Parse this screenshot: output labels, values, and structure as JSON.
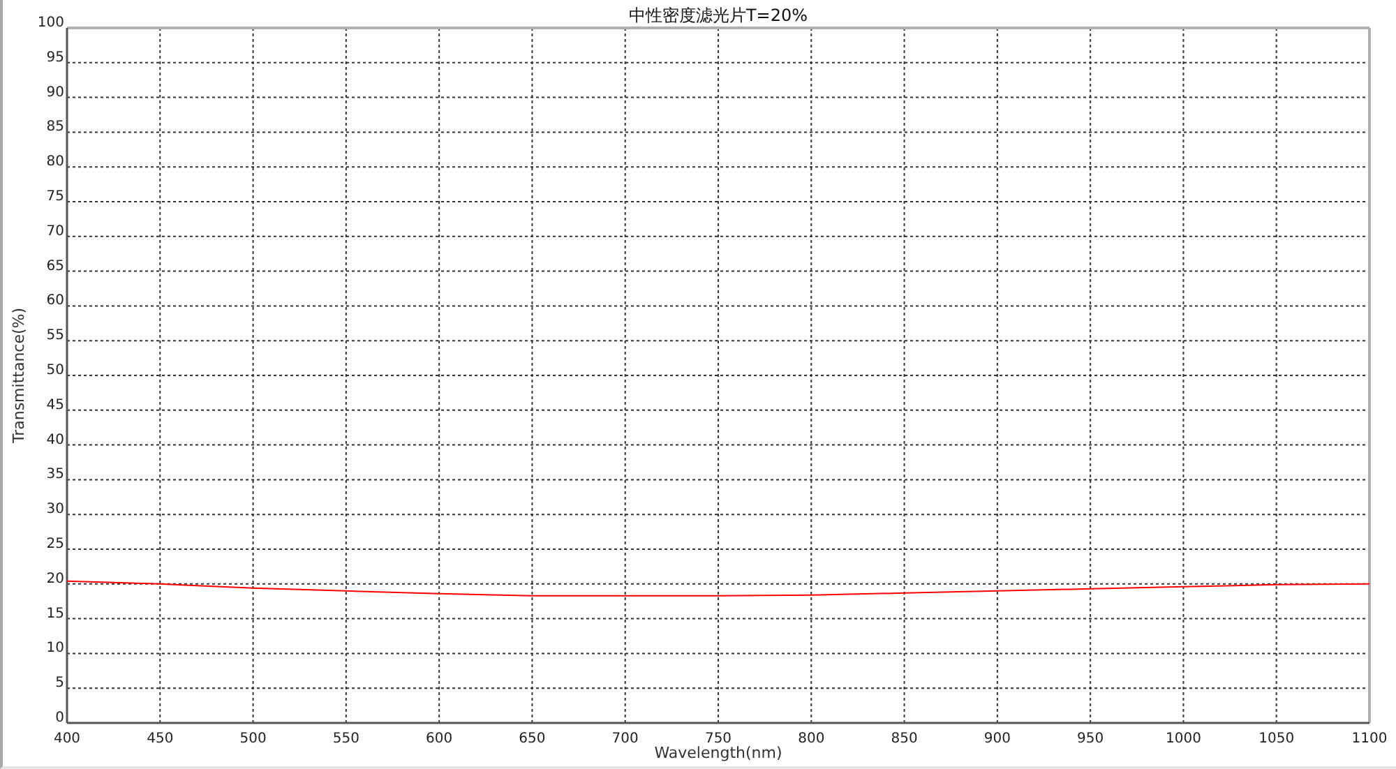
{
  "chart_data": {
    "type": "line",
    "title": "中性密度滤光片T=20%",
    "xlabel": "Wavelength(nm)",
    "ylabel": "Transmittance(%)",
    "x": [
      400,
      450,
      500,
      550,
      600,
      650,
      700,
      750,
      800,
      850,
      900,
      950,
      1000,
      1050,
      1100
    ],
    "grid": true,
    "series": [
      {
        "color": "#ff0000",
        "values": [
          20.4,
          20.0,
          19.4,
          19.0,
          18.6,
          18.3,
          18.3,
          18.3,
          18.4,
          18.7,
          19.0,
          19.3,
          19.6,
          19.9,
          20.0
        ]
      }
    ],
    "xlim": [
      400,
      1100
    ],
    "ylim": [
      0,
      100
    ],
    "xticks": [
      400,
      450,
      500,
      550,
      600,
      650,
      700,
      750,
      800,
      850,
      900,
      950,
      1000,
      1050,
      1100
    ],
    "yticks": [
      0,
      5,
      10,
      15,
      20,
      25,
      30,
      35,
      40,
      45,
      50,
      55,
      60,
      65,
      70,
      75,
      80,
      85,
      90,
      95,
      100
    ]
  }
}
